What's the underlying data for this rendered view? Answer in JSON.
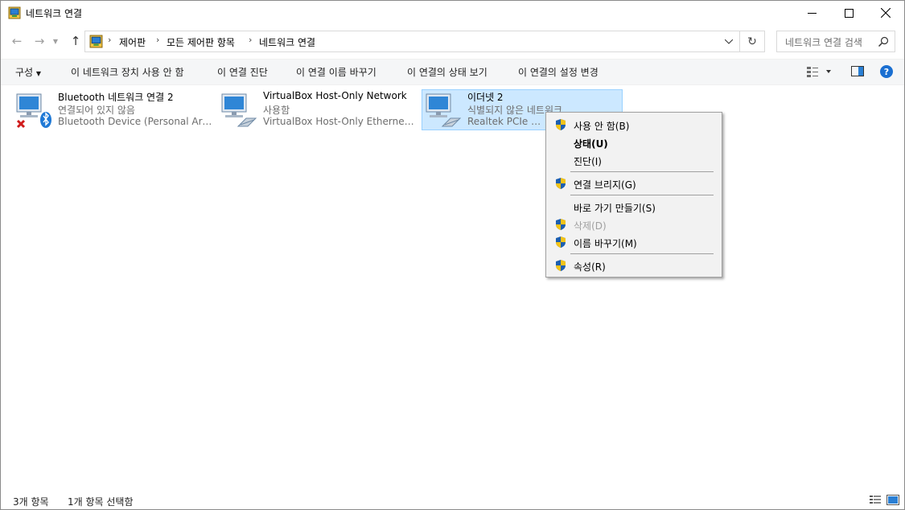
{
  "window": {
    "title": "네트워크 연결"
  },
  "breadcrumb": [
    "제어판",
    "모든 제어판 항목",
    "네트워크 연결"
  ],
  "search": {
    "placeholder": "네트워크 연결 검색"
  },
  "toolbar": {
    "organize": "구성",
    "actions": [
      "이 네트워크 장치 사용 안 함",
      "이 연결 진단",
      "이 연결 이름 바꾸기",
      "이 연결의 상태 보기",
      "이 연결의 설정 변경"
    ]
  },
  "items": [
    {
      "name": "Bluetooth 네트워크 연결 2",
      "status": "연결되어 있지 않음",
      "device": "Bluetooth Device (Personal Area ...",
      "selected": false
    },
    {
      "name": "VirtualBox Host-Only Network",
      "status": "사용함",
      "device": "VirtualBox Host-Only Ethernet A...",
      "selected": false
    },
    {
      "name": "이더넷 2",
      "status": "식별되지 않은 네트워크",
      "device": "Realtek PCIe GbE F",
      "selected": true
    }
  ],
  "context_menu": [
    {
      "label": "사용 안 함(B)",
      "shield": true,
      "bold": false,
      "disabled": false
    },
    {
      "label": "상태(U)",
      "shield": false,
      "bold": true,
      "disabled": false
    },
    {
      "label": "진단(I)",
      "shield": false,
      "bold": false,
      "disabled": false
    },
    {
      "label": "연결 브리지(G)",
      "shield": true,
      "bold": false,
      "disabled": false
    },
    {
      "label": "바로 가기 만들기(S)",
      "shield": false,
      "bold": false,
      "disabled": false
    },
    {
      "label": "삭제(D)",
      "shield": true,
      "bold": false,
      "disabled": true
    },
    {
      "label": "이름 바꾸기(M)",
      "shield": true,
      "bold": false,
      "disabled": false
    },
    {
      "label": "속성(R)",
      "shield": true,
      "bold": false,
      "disabled": false
    }
  ],
  "statusbar": {
    "count": "3개 항목",
    "selected": "1개 항목 선택함"
  },
  "colors": {
    "selection_bg": "#cce8ff",
    "selection_border": "#99d1ff",
    "help_blue": "#1a6fd1"
  }
}
